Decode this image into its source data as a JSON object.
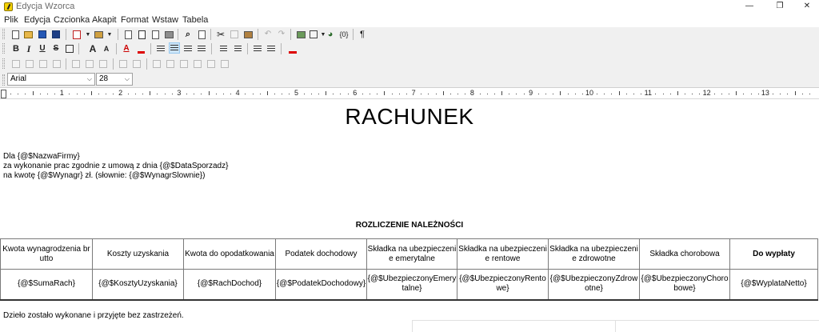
{
  "window": {
    "title": "Edycja Wzorca",
    "minimize": "—",
    "restore": "❐",
    "close": "✕"
  },
  "menu": [
    "Plik",
    "Edycja",
    "Czcionka",
    "Akapit",
    "Format",
    "Wstaw",
    "Tabela"
  ],
  "toolbar": {
    "bold": "B",
    "italic": "I",
    "underline": "U",
    "strike": "S",
    "field_button": "{0}",
    "pilcrow": "¶"
  },
  "format": {
    "font_name": "Arial",
    "font_size": "28"
  },
  "ruler": {
    "numbers": [
      "1",
      "2",
      "3",
      "4",
      "5",
      "6",
      "7",
      "8",
      "9",
      "10",
      "11",
      "12",
      "13"
    ]
  },
  "document": {
    "title": "RACHUNEK",
    "line1": "Dla {@$NazwaFirmy}",
    "line2": "za wykonanie prac zgodnie z umową z dnia {@$DataSporzadz}",
    "line3": "na kwotę {@$Wynagr} zł. (słownie: {@$WynagrSlownie})",
    "section_title": "ROZLICZENIE NALEŻNOŚCI",
    "table": {
      "headers": [
        "Kwota wynagrodzenia brutto",
        "Koszty uzyskania",
        "Kwota do opodatkowania",
        "Podatek dochodowy",
        "Składka na ubezpieczenie emerytalne",
        "Składka na ubezpieczenie rentowe",
        "Składka na ubezpieczenie zdrowotne",
        "Składka chorobowa",
        "Do wypłaty"
      ],
      "values": [
        "{@$SumaRach}",
        "{@$KosztyUzyskania}",
        "{@$RachDochod}",
        "{@$PodatekDochodowy}",
        "{@$UbezpieczonyEmerytalne}",
        "{@$UbezpieczonyRentowe}",
        "{@$UbezpieczonyZdrowotne}",
        "{@$UbezpieczonyChorobowe}",
        "{@$WyplataNetto}"
      ]
    },
    "footer_note": "Dzieło zostało wykonane i przyjęte bez zastrzeżeń."
  }
}
